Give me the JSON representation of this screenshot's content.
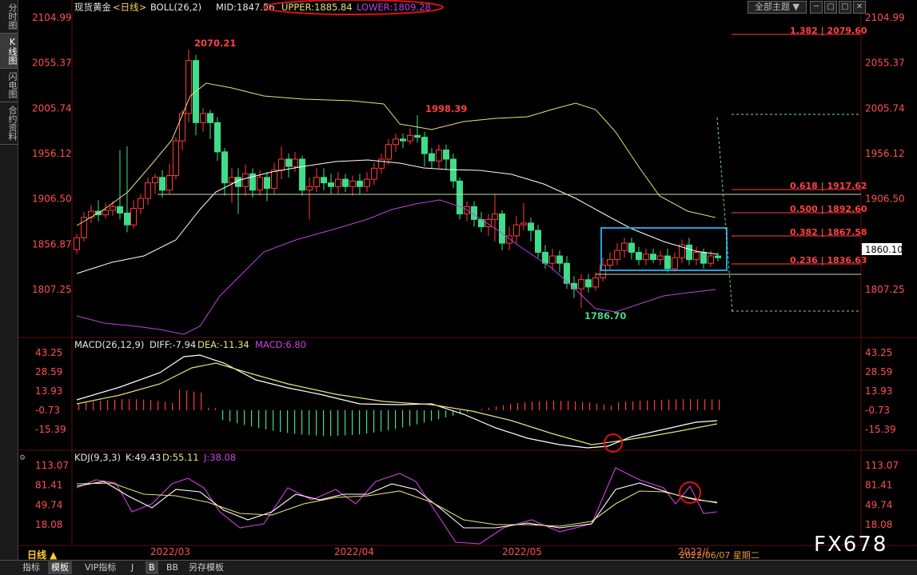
{
  "left_tabs": [
    "分时图",
    "K线图",
    "闪电图",
    "合约资料"
  ],
  "header": {
    "instrument": "现货黄金",
    "period": "<日线>",
    "boll_label": "BOLL(26,2)",
    "mid": "MID:1847.56",
    "upper": "UPPER:1885.84",
    "lower": "LOWER:1809.28"
  },
  "top_right": {
    "theme_button": "全部主题",
    "theme_arrow": "▼"
  },
  "price_axis": [
    "2104.99",
    "2055.37",
    "2005.74",
    "1956.12",
    "1906.50",
    "1856.87",
    "1807.25"
  ],
  "fib_levels": [
    {
      "ratio": "1.382",
      "price": "2079.60",
      "label": "1.382 | 2079.60"
    },
    {
      "ratio": "0.618",
      "price": "1917.62",
      "label": "0.618 | 1917.62"
    },
    {
      "ratio": "0.500",
      "price": "1892.60",
      "label": "0.500 | 1892.60"
    },
    {
      "ratio": "0.382",
      "price": "1867.58",
      "label": "0.382 | 1867.58"
    },
    {
      "ratio": "0.236",
      "price": "1836.63",
      "label": "0.236 | 1836.63"
    }
  ],
  "price_annotations": {
    "high": "2070.21",
    "mid_high": "1998.39",
    "low": "1786.70",
    "current": "1860.10"
  },
  "macd": {
    "label": "MACD(26,12,9)",
    "diff": "DIFF:-7.94",
    "dea": "DEA:-11.34",
    "macd": "MACD:6.80",
    "axis": [
      "43.25",
      "28.59",
      "13.93",
      "-0.73",
      "-15.39"
    ]
  },
  "kdj": {
    "label": "KDJ(9,3,3)",
    "k": "K:49.43",
    "d": "D:55.11",
    "j": "J:38.08",
    "axis": [
      "113.07",
      "81.41",
      "49.74",
      "18.08"
    ]
  },
  "x_axis": [
    "2022/03",
    "2022/04",
    "2022/05",
    "2022/("
  ],
  "period_label": "日线 ▲",
  "date_label": "2022/06/07 星期二",
  "bottom_tabs": [
    "指标",
    "模板",
    "VIP指标",
    "J",
    "B",
    "BB",
    "另存模板"
  ],
  "watermark": "FX678",
  "colors": {
    "up": "#ff3b3b",
    "down": "#3fdc8a",
    "boll_upper": "#e8e27a",
    "boll_mid": "#ffffff",
    "boll_lower": "#c040e0",
    "fib": "#ff4040",
    "box": "#1fa0e0",
    "macd_dea": "#e8e27a",
    "kdj_j": "#d040e0",
    "axis_text": "#ff5050"
  },
  "chart_data": [
    {
      "type": "candlestick",
      "x": [
        "2022/03",
        "2022/04",
        "2022/05",
        "2022/("
      ],
      "ylim": [
        1807.25,
        2104.99
      ],
      "series": [
        {
          "name": "UPPER",
          "values": [
            1885.84
          ]
        },
        {
          "name": "MID",
          "values": [
            1847.56
          ]
        },
        {
          "name": "LOWER",
          "values": [
            1809.28
          ]
        }
      ],
      "annotations": [
        "2070.21",
        "1998.39",
        "1786.70"
      ],
      "fib_levels": [
        2079.6,
        1917.62,
        1892.6,
        1867.58,
        1836.63
      ]
    },
    {
      "type": "bar",
      "series": [
        {
          "name": "DIFF",
          "values": [
            -7.94
          ]
        },
        {
          "name": "DEA",
          "values": [
            -11.34
          ]
        },
        {
          "name": "MACD",
          "values": [
            6.8
          ]
        }
      ],
      "ylim": [
        -15.39,
        43.25
      ]
    },
    {
      "type": "line",
      "series": [
        {
          "name": "K",
          "values": [
            49.43
          ]
        },
        {
          "name": "D",
          "values": [
            55.11
          ]
        },
        {
          "name": "J",
          "values": [
            38.08
          ]
        }
      ],
      "ylim": [
        18.08,
        113.07
      ]
    }
  ]
}
